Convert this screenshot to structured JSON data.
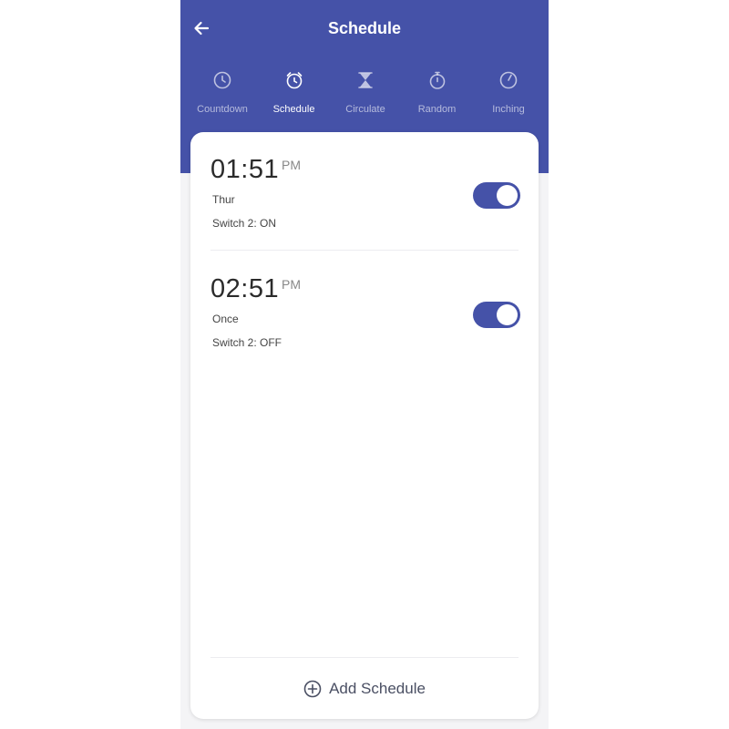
{
  "header": {
    "title": "Schedule",
    "background_color": "#4552a8"
  },
  "tabs": [
    {
      "label": "Countdown",
      "icon": "clock-icon",
      "active": false
    },
    {
      "label": "Schedule",
      "icon": "alarm-clock-icon",
      "active": true
    },
    {
      "label": "Circulate",
      "icon": "hourglass-icon",
      "active": false
    },
    {
      "label": "Random",
      "icon": "stopwatch-icon",
      "active": false
    },
    {
      "label": "Inching",
      "icon": "clock-hand-icon",
      "active": false
    }
  ],
  "schedules": [
    {
      "time": "01:51",
      "ampm": "PM",
      "repeat": "Thur",
      "action": "Switch 2: ON",
      "enabled": true
    },
    {
      "time": "02:51",
      "ampm": "PM",
      "repeat": "Once",
      "action": "Switch 2: OFF",
      "enabled": true
    }
  ],
  "add_button": {
    "label": "Add Schedule",
    "icon": "plus-circle-icon"
  },
  "colors": {
    "accent": "#4552a8",
    "card": "#ffffff",
    "background": "#f4f4f6"
  }
}
